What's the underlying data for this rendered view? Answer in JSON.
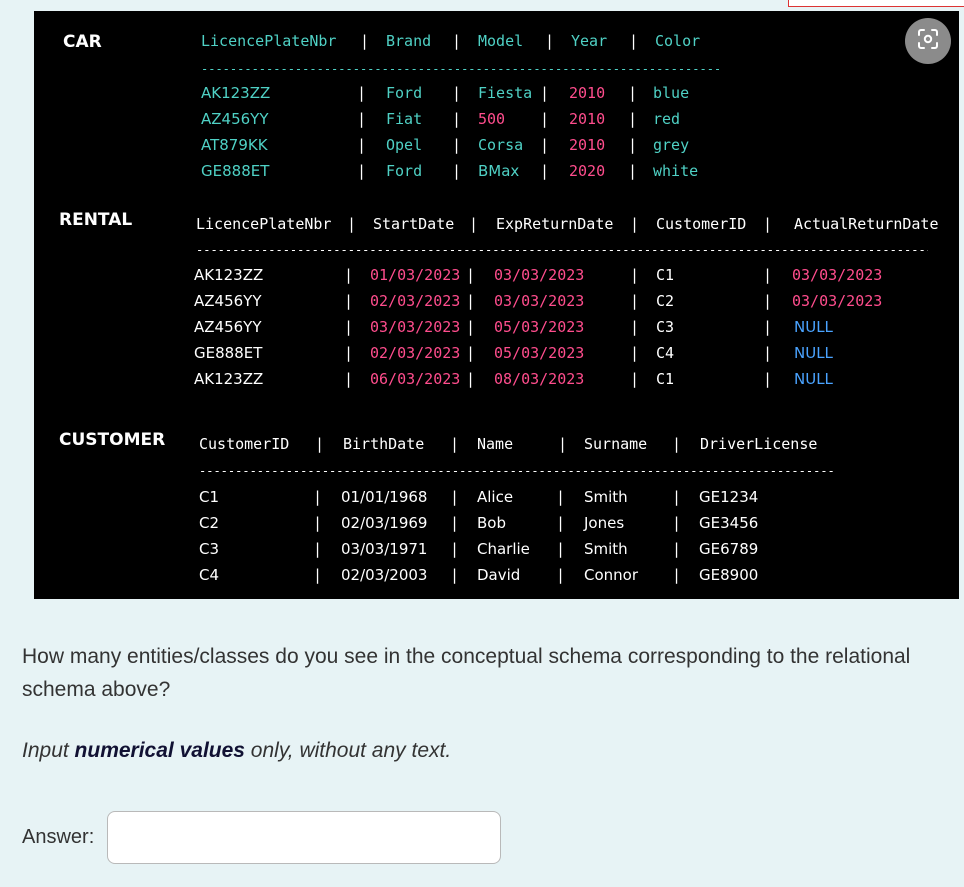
{
  "car": {
    "label": "CAR",
    "header": [
      "LicencePlateNbr",
      "Brand",
      "Model",
      "Year",
      "Color"
    ],
    "rows": [
      [
        "AK123ZZ",
        "Ford",
        "Fiesta",
        "2010",
        "blue"
      ],
      [
        "AZ456YY",
        "Fiat",
        "500",
        "2010",
        "red"
      ],
      [
        "AT879KK",
        "Opel",
        "Corsa",
        "2010",
        "grey"
      ],
      [
        "GE888ET",
        "Ford",
        "BMax",
        "2020",
        "white"
      ]
    ]
  },
  "rental": {
    "label": "RENTAL",
    "header": [
      "LicencePlateNbr",
      "StartDate",
      "ExpReturnDate",
      "CustomerID",
      "ActualReturnDate"
    ],
    "rows": [
      [
        "AK123ZZ",
        "01/03/2023",
        "03/03/2023",
        "C1",
        "03/03/2023"
      ],
      [
        "AZ456YY",
        "02/03/2023",
        "03/03/2023",
        "C2",
        "03/03/2023"
      ],
      [
        "AZ456YY",
        "03/03/2023",
        "05/03/2023",
        "C3",
        "NULL"
      ],
      [
        "GE888ET",
        "02/03/2023",
        "05/03/2023",
        "C4",
        "NULL"
      ],
      [
        "AK123ZZ",
        "06/03/2023",
        "08/03/2023",
        "C1",
        "NULL"
      ]
    ]
  },
  "customer": {
    "label": "CUSTOMER",
    "header": [
      "CustomerID",
      "BirthDate",
      "Name",
      "Surname",
      "DriverLicense"
    ],
    "rows": [
      [
        "C1",
        "01/01/1968",
        "Alice",
        "Smith",
        "GE1234"
      ],
      [
        "C2",
        "02/03/1969",
        "Bob",
        "Jones",
        "GE3456"
      ],
      [
        "C3",
        "03/03/1971",
        "Charlie",
        "Smith",
        "GE6789"
      ],
      [
        "C4",
        "02/03/2003",
        "David",
        "Connor",
        "GE8900"
      ]
    ]
  },
  "separator": "|",
  "question": {
    "text": "How many entities/classes do you see in the conceptual schema corresponding to the relational schema above?",
    "instruction_before": "Input ",
    "instruction_bold": "numerical values",
    "instruction_after": " only, without any text.",
    "answer_label": "Answer:",
    "answer_value": ""
  },
  "icons": {
    "camera": "camera-icon"
  },
  "colors": {
    "header_teal": "#4fd1c5",
    "date_pink": "#ff4d8d",
    "null_blue": "#4aa3ff",
    "panel_bg": "#000000",
    "page_bg": "#e7f3f5"
  }
}
